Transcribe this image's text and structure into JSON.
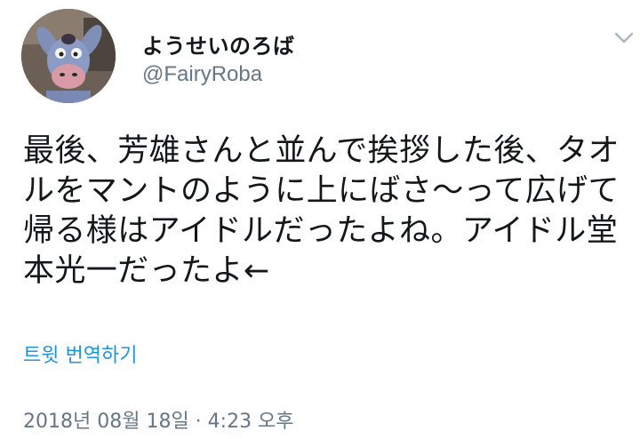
{
  "tweet": {
    "author": {
      "display_name": "ようせいのろば",
      "handle": "@FairyRoba",
      "avatar_icon": "eeyore-plush-avatar"
    },
    "menu_icon": "chevron-down-icon",
    "text": "最後、芳雄さんと並んで挨拶した後、タオルをマントのように上にばさ〜って広げて帰る様はアイドルだったよね。アイドル堂本光一だったよ←",
    "translate_label": "트윗 번역하기",
    "timestamp": "2018년 08월 18일 · 4:23 오후"
  },
  "colors": {
    "link": "#1b95e0",
    "secondary_text": "#657786",
    "primary_text": "#14171a"
  }
}
